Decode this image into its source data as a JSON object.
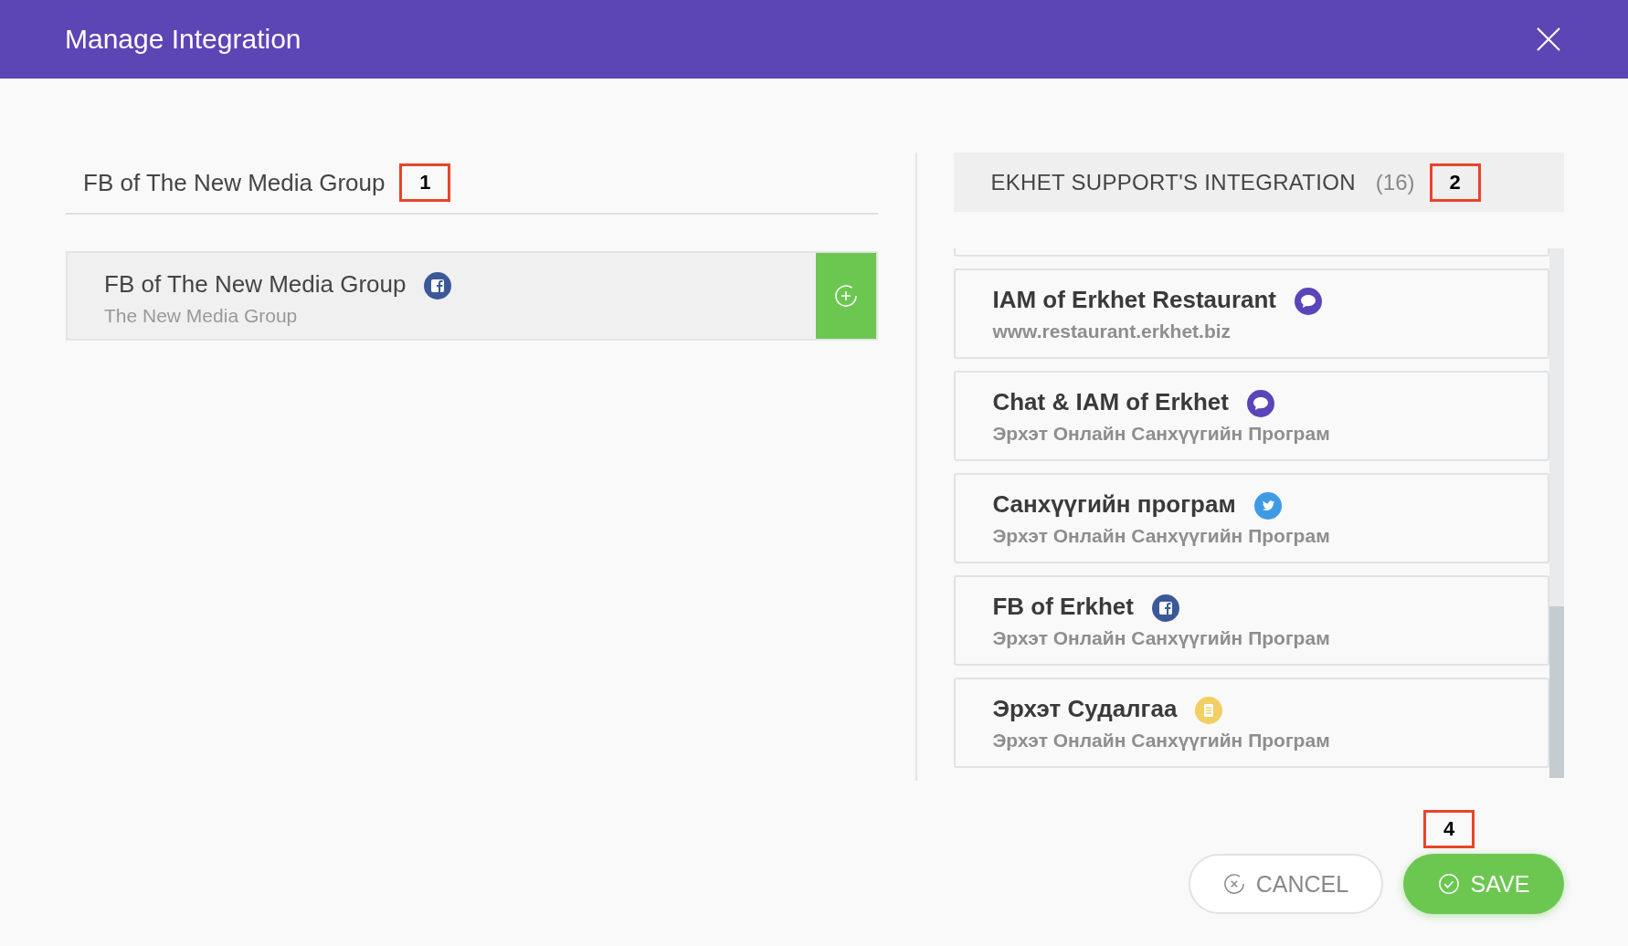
{
  "window": {
    "title": "Manage Integration"
  },
  "left_panel": {
    "title": "FB of The New Media Group",
    "callout": "1",
    "items": [
      {
        "name": "FB of The New Media Group",
        "subtitle": "The New Media Group",
        "kind": "facebook"
      }
    ]
  },
  "right_panel": {
    "title": "EKHET SUPPORT'S INTEGRATION",
    "count": "(16)",
    "callout": "2",
    "items": [
      {
        "name": "IAM of Erkhet Restaurant",
        "subtitle": "www.restaurant.erkhet.biz",
        "kind": "chat"
      },
      {
        "name": "Chat & IAM of Erkhet",
        "subtitle": "Эрхэт Онлайн Санхүүгийн Програм",
        "kind": "chat"
      },
      {
        "name": "Санхүүгийн програм",
        "subtitle": "Эрхэт Онлайн Санхүүгийн Програм",
        "kind": "twitter"
      },
      {
        "name": "FB of Erkhet",
        "subtitle": "Эрхэт Онлайн Санхүүгийн Програм",
        "kind": "facebook"
      },
      {
        "name": "Эрхэт Судалгаа",
        "subtitle": "Эрхэт Онлайн Санхүүгийн Програм",
        "kind": "survey"
      }
    ]
  },
  "footer": {
    "callout": "4",
    "buttons": [
      {
        "label": "CANCEL",
        "kind": "cancel"
      },
      {
        "label": "SAVE",
        "kind": "save"
      }
    ]
  }
}
